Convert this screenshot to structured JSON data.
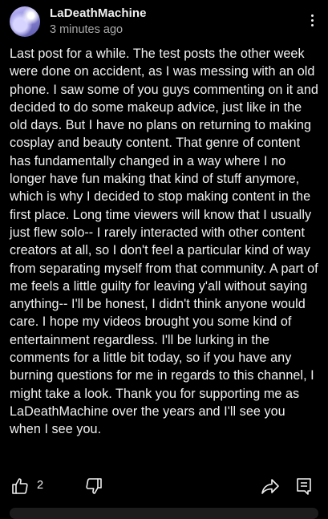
{
  "post": {
    "author": "LaDeathMachine",
    "time": "3 minutes ago",
    "text": "Last post for a while. The test posts the other week were done on accident, as I was messing with an old phone. I saw some of you guys commenting on it and decided to do some makeup advice, just like in the old days. But I have no plans on returning to making cosplay and beauty content. That genre of content has fundamentally changed in a way where I no longer have fun making that kind of stuff anymore, which is why I decided to stop making content in the first place. Long time viewers will know that I usually just flew solo-- I rarely interacted with other content creators at all, so I don't feel a particular kind of way from separating myself from that community. A part of me feels a little guilty for leaving y'all without saying anything-- I'll be honest, I didn't think anyone would care. I hope my videos brought you some kind of entertainment regardless. I'll be lurking in the comments for a little bit today, so if you have any burning questions for me in regards to this channel, I might take a look.  Thank you for supporting me as LaDeathMachine over the years and I'll see you when I see you.",
    "like_count": "2"
  },
  "icons": {
    "like": "thumbs-up-icon",
    "dislike": "thumbs-down-icon",
    "share": "share-arrow-icon",
    "comments": "comment-icon",
    "menu": "more-vertical-icon"
  },
  "colors": {
    "background": "#000000",
    "text": "#f1f1f1",
    "secondary_text": "#aaaaaa"
  }
}
